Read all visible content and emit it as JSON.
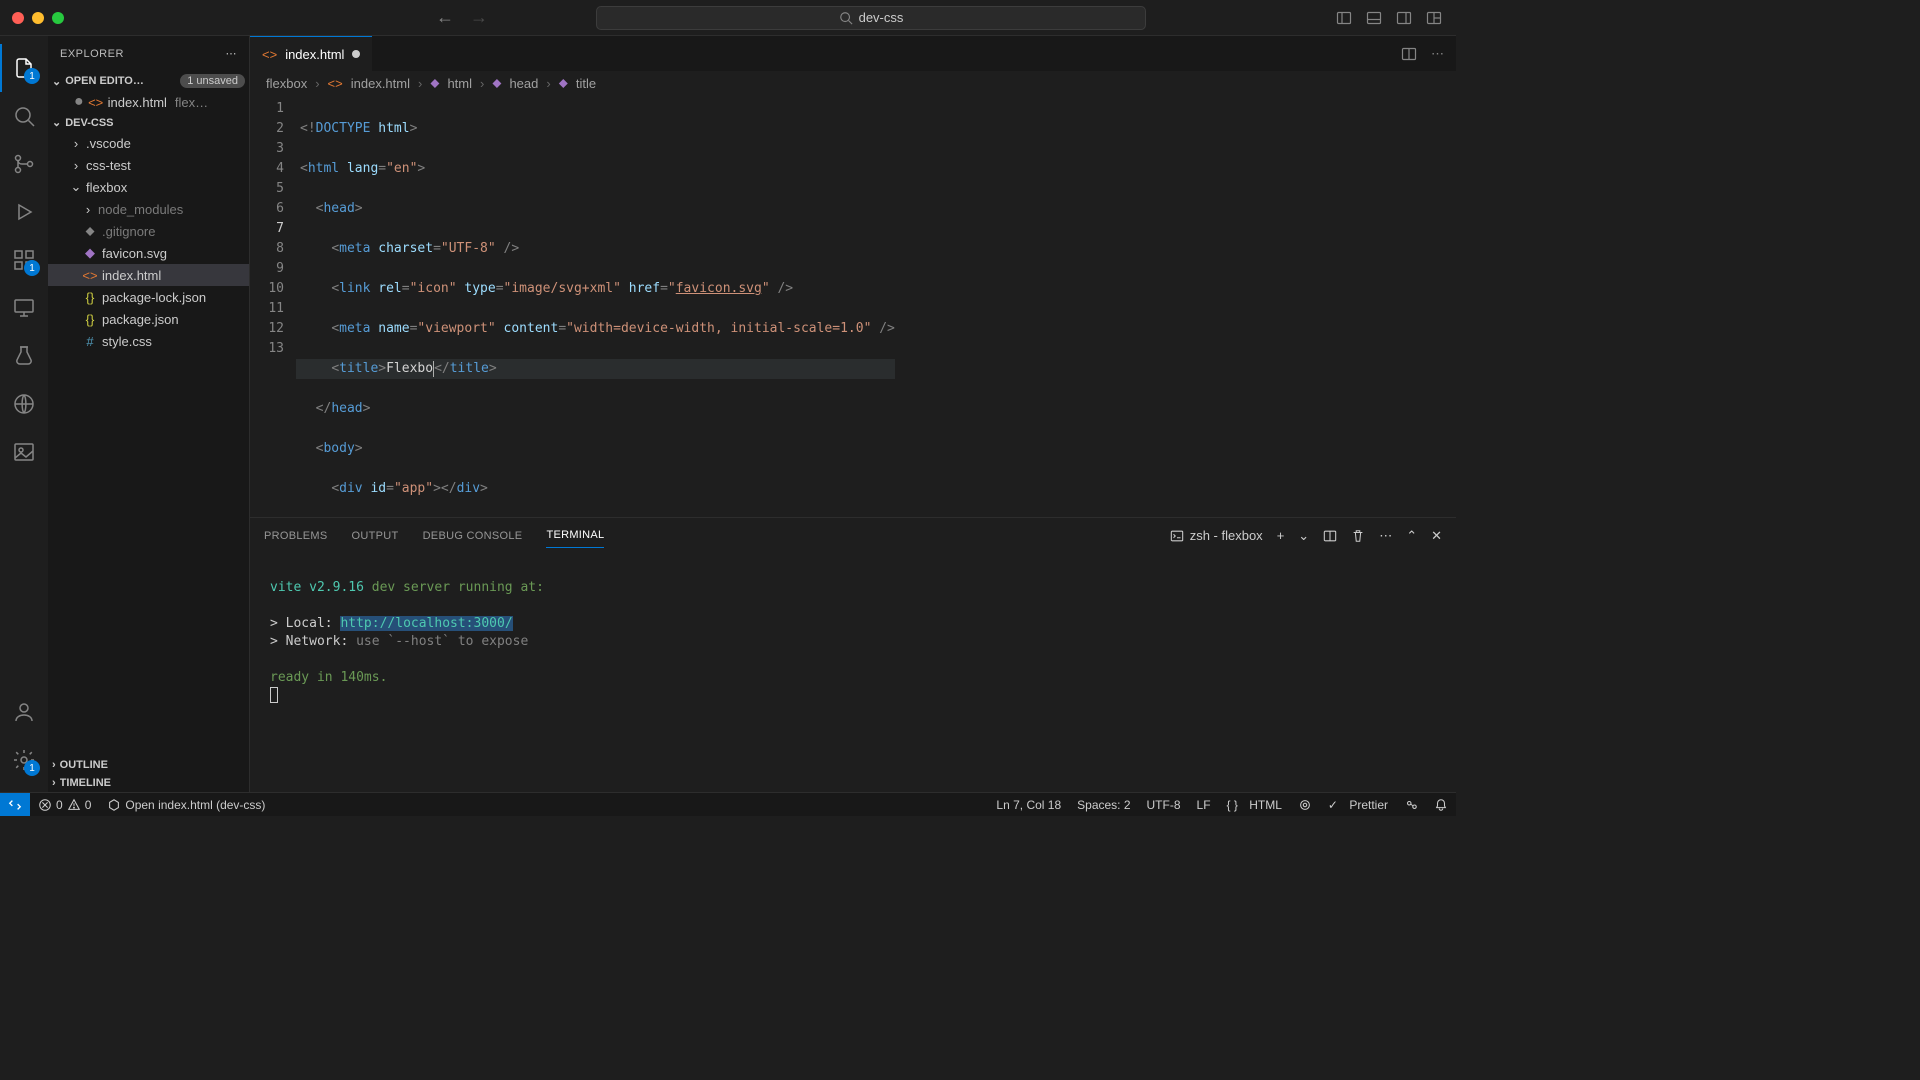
{
  "titlebar": {
    "search": "dev-css"
  },
  "activity": {
    "badge1": "1",
    "badge2": "1",
    "badge3": "1"
  },
  "sidebar": {
    "title": "EXPLORER",
    "openEditors": {
      "label": "OPEN EDITO…",
      "unsaved": "1 unsaved"
    },
    "openFile": {
      "name": "index.html",
      "hint": "flex…"
    },
    "project": "DEV-CSS",
    "items": {
      "vscode": ".vscode",
      "csstest": "css-test",
      "flexbox": "flexbox",
      "node": "node_modules",
      "gitignore": ".gitignore",
      "favicon": "favicon.svg",
      "index": "index.html",
      "pkglock": "package-lock.json",
      "pkg": "package.json",
      "style": "style.css"
    },
    "outline": "OUTLINE",
    "timeline": "TIMELINE"
  },
  "tabs": {
    "file": "index.html"
  },
  "breadcrumb": {
    "p1": "flexbox",
    "p2": "index.html",
    "p3": "html",
    "p4": "head",
    "p5": "title"
  },
  "editor": {
    "lines": [
      "1",
      "2",
      "3",
      "4",
      "5",
      "6",
      "7",
      "8",
      "9",
      "10",
      "11",
      "12",
      "13"
    ]
  },
  "panel": {
    "tabs": {
      "problems": "PROBLEMS",
      "output": "OUTPUT",
      "debug": "DEBUG CONSOLE",
      "terminal": "TERMINAL"
    },
    "shell": "zsh - flexbox",
    "terminal": {
      "l1a": "vite v2.9.16",
      "l1b": " dev server running at:",
      "l2a": "> Local:   ",
      "l2b": "http://localhost:3000/",
      "l3a": "> Network: ",
      "l3b": "use `--host` to expose",
      "l4": "ready in 140ms."
    }
  },
  "statusbar": {
    "errors": "0",
    "warnings": "0",
    "open": "Open index.html (dev-css)",
    "pos": "Ln 7, Col 18",
    "spaces": "Spaces: 2",
    "encoding": "UTF-8",
    "eol": "LF",
    "lang": "HTML",
    "prettier": "Prettier"
  }
}
